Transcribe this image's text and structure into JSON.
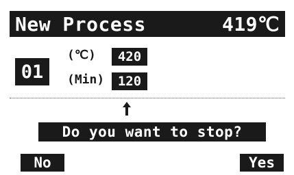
{
  "header": {
    "title": "New Process",
    "current_temp": "419℃"
  },
  "program": {
    "number": "01"
  },
  "params": {
    "temp_label": "(℃)",
    "temp_value": "420",
    "time_label": "(Min)",
    "time_value": "120"
  },
  "pointer": {
    "icon": "up-arrow-icon"
  },
  "dialog": {
    "prompt": "Do you want to stop?"
  },
  "softkeys": {
    "left": "No",
    "right": "Yes"
  },
  "colors": {
    "foreground": "#1a1a1a",
    "background": "#ffffff"
  }
}
